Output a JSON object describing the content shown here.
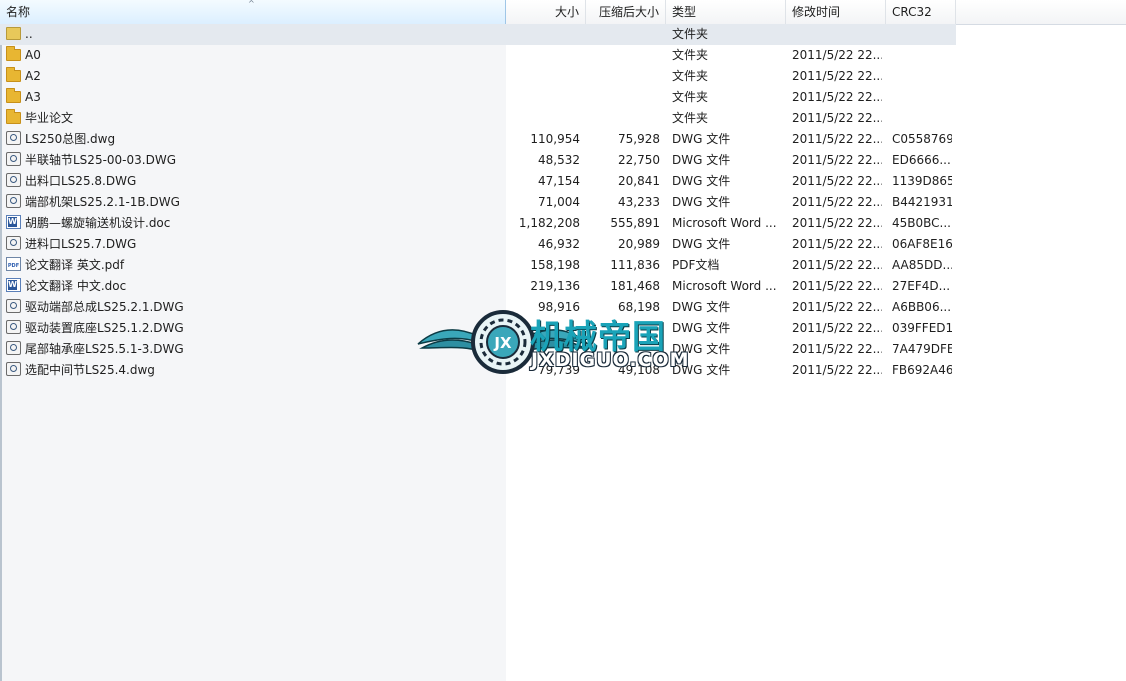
{
  "columns": {
    "name": "名称",
    "size": "大小",
    "packed": "压缩后大小",
    "type": "类型",
    "modified": "修改时间",
    "crc": "CRC32"
  },
  "sort_indicator": "^",
  "files": [
    {
      "name": "..",
      "size": "",
      "packed": "",
      "type": "文件夹",
      "modified": "",
      "crc": "",
      "icon": "folder-up-icon"
    },
    {
      "name": "A0",
      "size": "",
      "packed": "",
      "type": "文件夹",
      "modified": "2011/5/22 22...",
      "crc": "",
      "icon": "folder-icon"
    },
    {
      "name": "A2",
      "size": "",
      "packed": "",
      "type": "文件夹",
      "modified": "2011/5/22 22...",
      "crc": "",
      "icon": "folder-icon"
    },
    {
      "name": "A3",
      "size": "",
      "packed": "",
      "type": "文件夹",
      "modified": "2011/5/22 22...",
      "crc": "",
      "icon": "folder-icon"
    },
    {
      "name": "毕业论文",
      "size": "",
      "packed": "",
      "type": "文件夹",
      "modified": "2011/5/22 22...",
      "crc": "",
      "icon": "folder-icon"
    },
    {
      "name": "LS250总图.dwg",
      "size": "110,954",
      "packed": "75,928",
      "type": "DWG 文件",
      "modified": "2011/5/22 22...",
      "crc": "C0558769",
      "icon": "dwg-file-icon"
    },
    {
      "name": "半联轴节LS25-00-03.DWG",
      "size": "48,532",
      "packed": "22,750",
      "type": "DWG 文件",
      "modified": "2011/5/22 22...",
      "crc": "ED6666...",
      "icon": "dwg-file-icon"
    },
    {
      "name": "出料口LS25.8.DWG",
      "size": "47,154",
      "packed": "20,841",
      "type": "DWG 文件",
      "modified": "2011/5/22 22...",
      "crc": "1139D865",
      "icon": "dwg-file-icon"
    },
    {
      "name": "端部机架LS25.2.1-1B.DWG",
      "size": "71,004",
      "packed": "43,233",
      "type": "DWG 文件",
      "modified": "2011/5/22 22...",
      "crc": "B4421931",
      "icon": "dwg-file-icon"
    },
    {
      "name": "胡鹏—螺旋输送机设计.doc",
      "size": "1,182,208",
      "packed": "555,891",
      "type": "Microsoft Word ...",
      "modified": "2011/5/22 22...",
      "crc": "45B0BC...",
      "icon": "word-doc-icon"
    },
    {
      "name": "进料口LS25.7.DWG",
      "size": "46,932",
      "packed": "20,989",
      "type": "DWG 文件",
      "modified": "2011/5/22 22...",
      "crc": "06AF8E16",
      "icon": "dwg-file-icon"
    },
    {
      "name": "论文翻译 英文.pdf",
      "size": "158,198",
      "packed": "111,836",
      "type": "PDF文档",
      "modified": "2011/5/22 22...",
      "crc": "AA85DD...",
      "icon": "pdf-file-icon"
    },
    {
      "name": "论文翻译 中文.doc",
      "size": "219,136",
      "packed": "181,468",
      "type": "Microsoft Word ...",
      "modified": "2011/5/22 22...",
      "crc": "27EF4D...",
      "icon": "word-doc-icon"
    },
    {
      "name": "驱动端部总成LS25.2.1.DWG",
      "size": "98,916",
      "packed": "68,198",
      "type": "DWG 文件",
      "modified": "2011/5/22 22...",
      "crc": "A6BB06...",
      "icon": "dwg-file-icon"
    },
    {
      "name": "驱动装置底座LS25.1.2.DWG",
      "size": "",
      "packed": "",
      "type": "DWG 文件",
      "modified": "2011/5/22 22...",
      "crc": "039FFED1",
      "icon": "dwg-file-icon"
    },
    {
      "name": "尾部轴承座LS25.5.1-3.DWG",
      "size": "",
      "packed": "",
      "type": "DWG 文件",
      "modified": "2011/5/22 22...",
      "crc": "7A479DFE",
      "icon": "dwg-file-icon"
    },
    {
      "name": "选配中间节LS25.4.dwg",
      "size": "79,739",
      "packed": "49,108",
      "type": "DWG 文件",
      "modified": "2011/5/22 22...",
      "crc": "FB692A46",
      "icon": "dwg-file-icon"
    }
  ],
  "watermark": {
    "logo_text": "JX",
    "title": "机械帝国",
    "url": "JXDIGUO.COM",
    "accent_color": "#1aa3b8"
  }
}
